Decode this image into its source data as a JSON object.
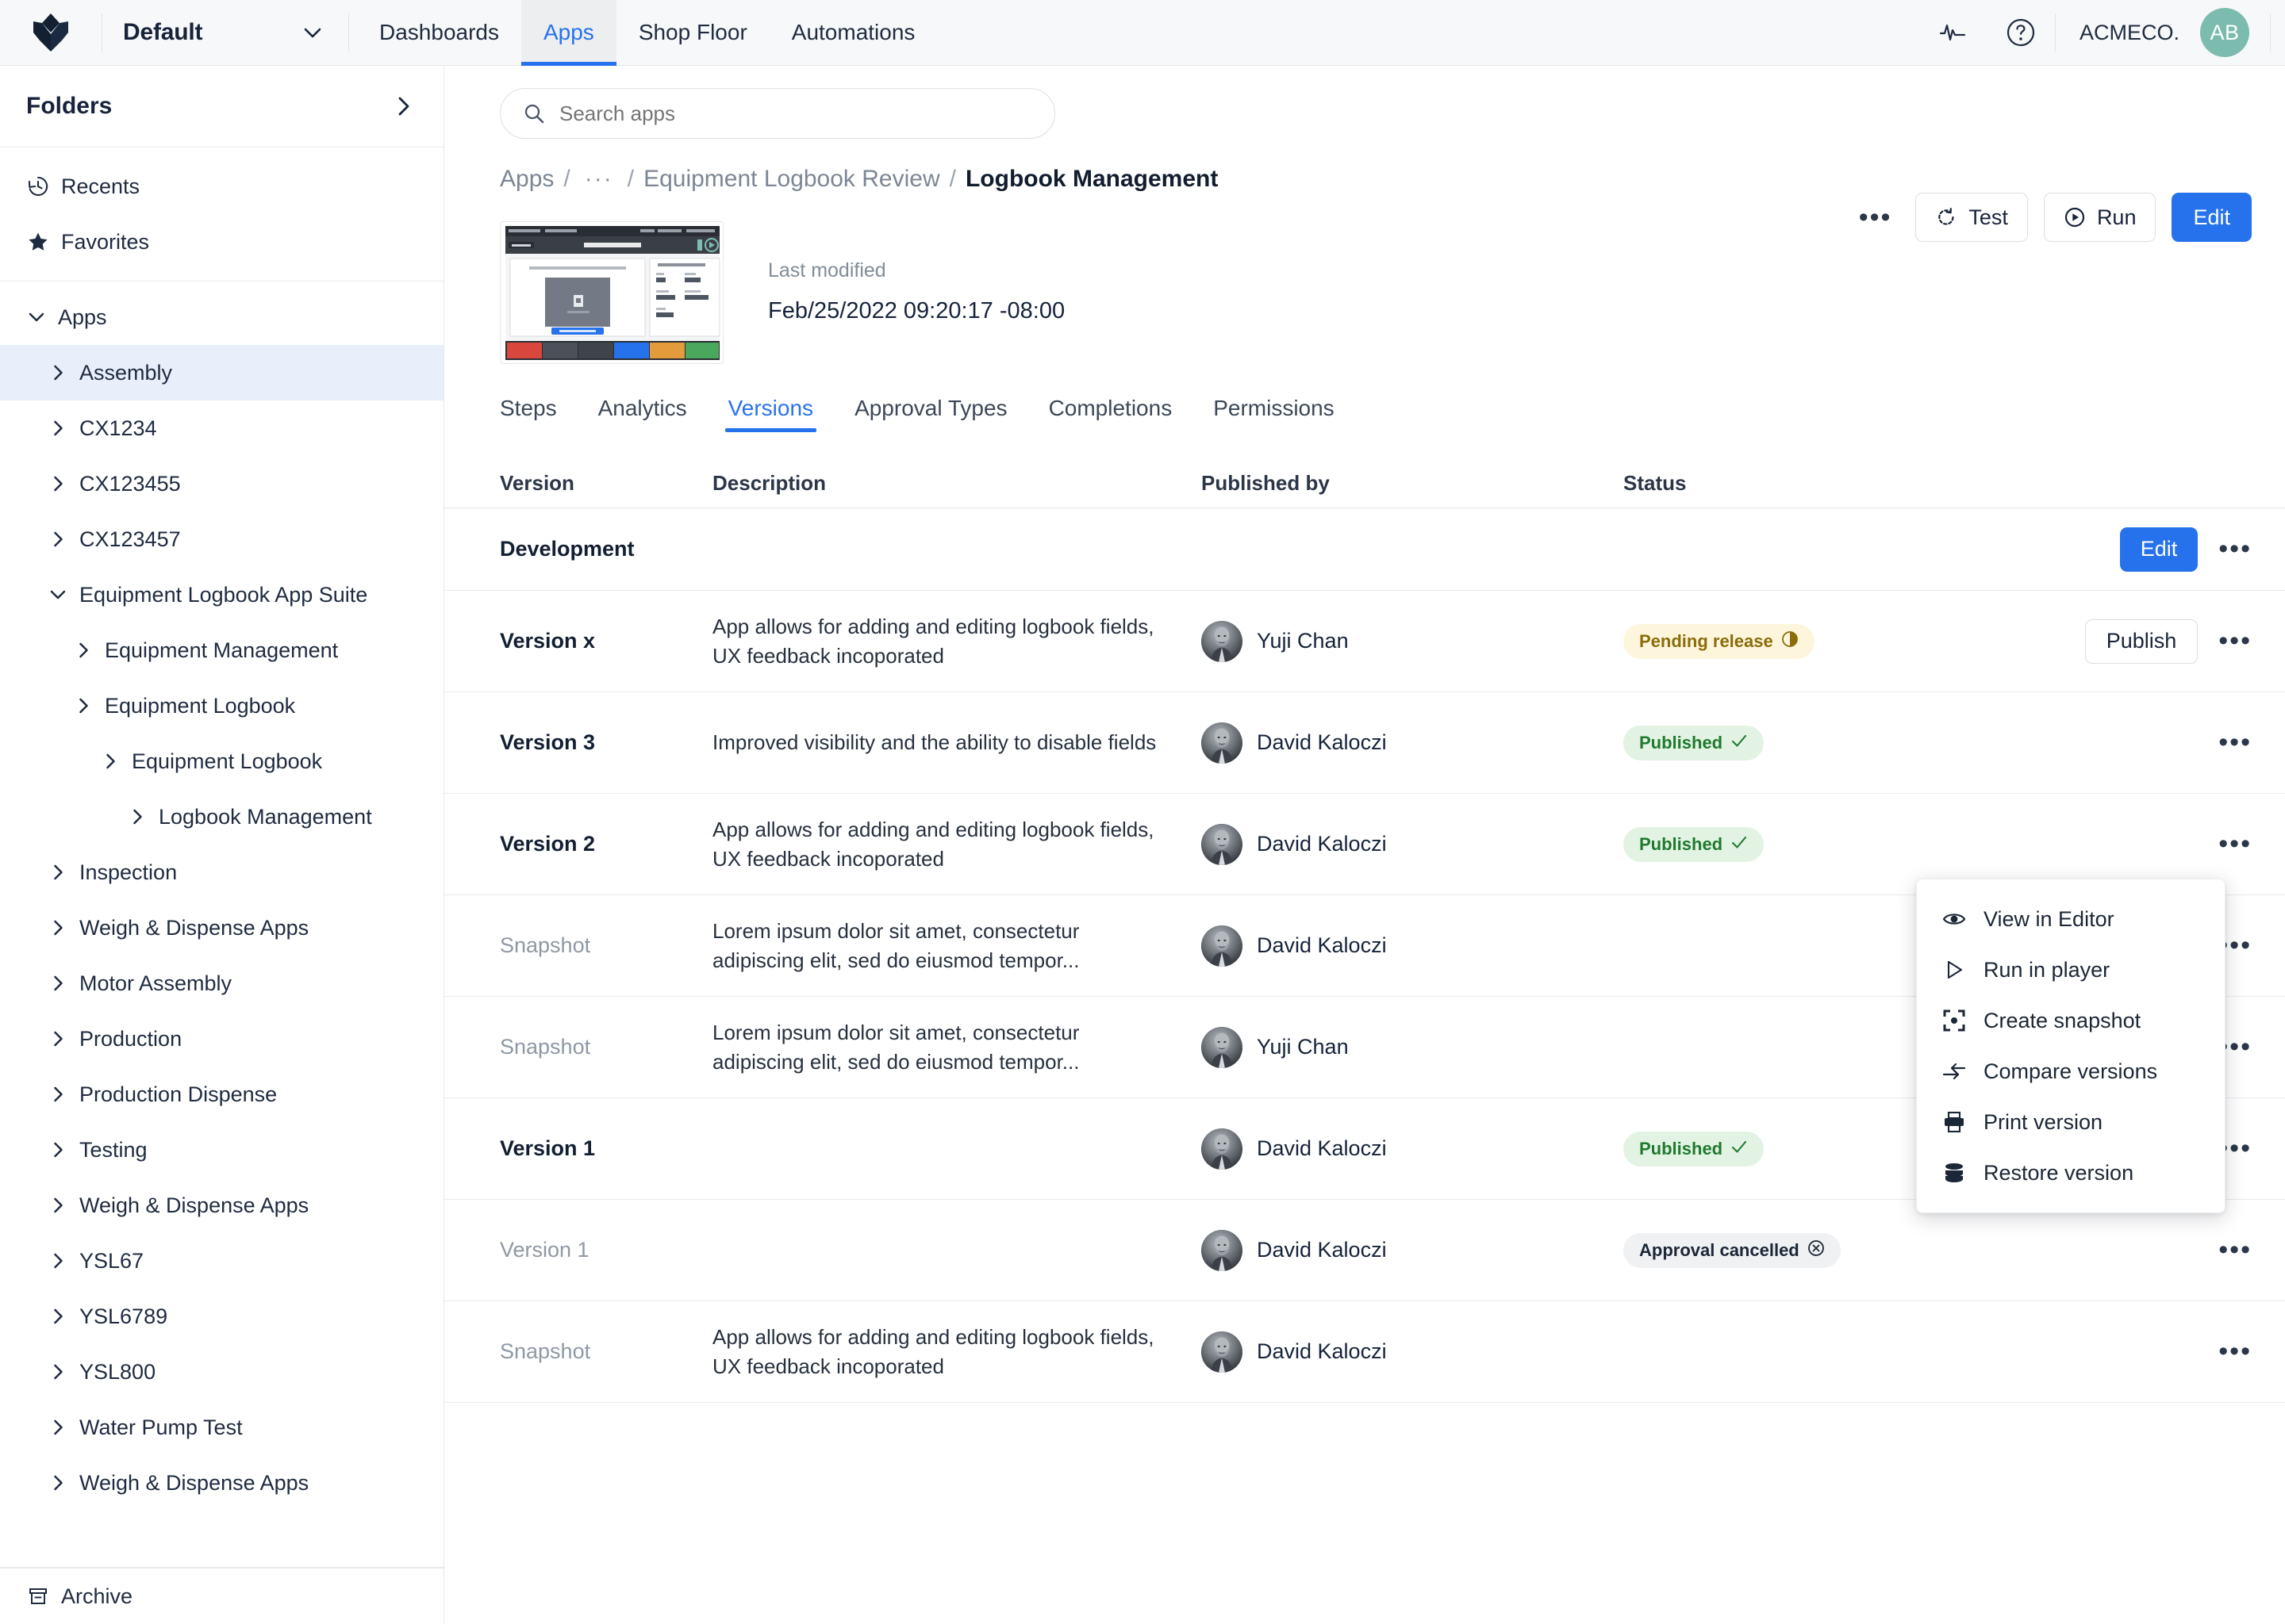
{
  "topbar": {
    "logo_icon": "tulip-logo-icon",
    "workspace": "Default",
    "workspace_chevron": "chevron-down-icon",
    "nav": [
      {
        "label": "Dashboards",
        "active": false
      },
      {
        "label": "Apps",
        "active": true
      },
      {
        "label": "Shop Floor",
        "active": false
      },
      {
        "label": "Automations",
        "active": false
      }
    ],
    "pulse_icon": "activity-pulse-icon",
    "help_icon": "help-circle-icon",
    "tenant": "ACMECO.",
    "avatar_initials": "AB"
  },
  "sidebar": {
    "title": "Folders",
    "collapse_icon": "chevron-right-icon",
    "quick": [
      {
        "label": "Recents",
        "icon": "history-icon"
      },
      {
        "label": "Favorites",
        "icon": "star-icon"
      }
    ],
    "tree": [
      {
        "label": "Apps",
        "level": 1,
        "state": "expanded",
        "selected": false
      },
      {
        "label": "Assembly",
        "level": 2,
        "state": "collapsed",
        "selected": true
      },
      {
        "label": "CX1234",
        "level": 2,
        "state": "collapsed",
        "selected": false
      },
      {
        "label": "CX123455",
        "level": 2,
        "state": "collapsed",
        "selected": false
      },
      {
        "label": "CX123457",
        "level": 2,
        "state": "collapsed",
        "selected": false
      },
      {
        "label": "Equipment Logbook App Suite",
        "level": 2,
        "state": "expanded",
        "selected": false
      },
      {
        "label": "Equipment Management",
        "level": 3,
        "state": "collapsed",
        "selected": false
      },
      {
        "label": "Equipment Logbook",
        "level": 3,
        "state": "collapsed",
        "selected": false
      },
      {
        "label": "Equipment Logbook",
        "level": 4,
        "state": "collapsed",
        "selected": false
      },
      {
        "label": "Logbook Management",
        "level": 5,
        "state": "collapsed",
        "selected": false
      },
      {
        "label": "Inspection",
        "level": 2,
        "state": "collapsed",
        "selected": false
      },
      {
        "label": "Weigh & Dispense Apps",
        "level": 2,
        "state": "collapsed",
        "selected": false
      },
      {
        "label": "Motor Assembly",
        "level": 2,
        "state": "collapsed",
        "selected": false
      },
      {
        "label": "Production",
        "level": 2,
        "state": "collapsed",
        "selected": false
      },
      {
        "label": "Production Dispense",
        "level": 2,
        "state": "collapsed",
        "selected": false
      },
      {
        "label": "Testing",
        "level": 2,
        "state": "collapsed",
        "selected": false
      },
      {
        "label": "Weigh & Dispense Apps",
        "level": 2,
        "state": "collapsed",
        "selected": false
      },
      {
        "label": "YSL67",
        "level": 2,
        "state": "collapsed",
        "selected": false
      },
      {
        "label": "YSL6789",
        "level": 2,
        "state": "collapsed",
        "selected": false
      },
      {
        "label": "YSL800",
        "level": 2,
        "state": "collapsed",
        "selected": false
      },
      {
        "label": "Water Pump Test",
        "level": 2,
        "state": "collapsed",
        "selected": false
      },
      {
        "label": "Weigh & Dispense Apps",
        "level": 2,
        "state": "collapsed",
        "selected": false
      }
    ],
    "archive": {
      "label": "Archive",
      "icon": "archive-icon"
    }
  },
  "search": {
    "placeholder": "Search apps",
    "value": "",
    "icon": "search-icon"
  },
  "breadcrumb": {
    "root": "Apps",
    "ellipsis": "···",
    "parent": "Equipment Logbook Review",
    "current": "Logbook Management",
    "separator": "/"
  },
  "header_actions": {
    "more_icon": "ellipsis-icon",
    "test_label": "Test",
    "test_icon": "rotate-ccw-icon",
    "run_label": "Run",
    "run_icon": "play-circle-icon",
    "edit_label": "Edit",
    "accent_color": "#2672ec"
  },
  "hero": {
    "thumbnail_icon": "app-preview-thumbnail",
    "last_modified_label": "Last modified",
    "last_modified_value": "Feb/25/2022 09:20:17 -08:00"
  },
  "tabs": [
    {
      "label": "Steps",
      "active": false
    },
    {
      "label": "Analytics",
      "active": false
    },
    {
      "label": "Versions",
      "active": true
    },
    {
      "label": "Approval Types",
      "active": false
    },
    {
      "label": "Completions",
      "active": false
    },
    {
      "label": "Permissions",
      "active": false
    }
  ],
  "table": {
    "columns": [
      "Version",
      "Description",
      "Published by",
      "Status"
    ],
    "dev_row": {
      "label": "Development",
      "edit_label": "Edit",
      "more_icon": "ellipsis-icon"
    },
    "rows": [
      {
        "version": "Version x",
        "version_muted": false,
        "description": "App allows for adding and editing logbook fields, UX feedback incoporated",
        "published_by": "Yuji Chan",
        "status": "Pending release",
        "status_kind": "pending",
        "status_icon": "half-moon-icon",
        "action_label": "Publish",
        "more_icon": "ellipsis-icon"
      },
      {
        "version": "Version 3",
        "version_muted": false,
        "description": "Improved visibility and the ability to disable fields",
        "published_by": "David Kaloczi",
        "status": "Published",
        "status_kind": "published",
        "status_icon": "check-icon",
        "action_label": "",
        "more_icon": "ellipsis-icon"
      },
      {
        "version": "Version 2",
        "version_muted": false,
        "description": "App allows for adding and editing logbook fields, UX feedback incoporated",
        "published_by": "David Kaloczi",
        "status": "Published",
        "status_kind": "published",
        "status_icon": "check-icon",
        "action_label": "",
        "more_icon": "ellipsis-icon"
      },
      {
        "version": "Snapshot",
        "version_muted": true,
        "description": "Lorem ipsum dolor sit amet, consectetur adipiscing elit, sed do eiusmod tempor...",
        "published_by": "David Kaloczi",
        "status": "",
        "status_kind": "none",
        "status_icon": "",
        "action_label": "",
        "more_icon": "ellipsis-icon"
      },
      {
        "version": "Snapshot",
        "version_muted": true,
        "description": "Lorem ipsum dolor sit amet, consectetur adipiscing elit, sed do eiusmod tempor...",
        "published_by": "Yuji Chan",
        "status": "",
        "status_kind": "none",
        "status_icon": "",
        "action_label": "",
        "more_icon": "ellipsis-icon"
      },
      {
        "version": "Version 1",
        "version_muted": false,
        "description": "",
        "published_by": "David Kaloczi",
        "status": "Published",
        "status_kind": "published",
        "status_icon": "check-icon",
        "action_label": "",
        "more_icon": "ellipsis-icon"
      },
      {
        "version": "Version 1",
        "version_muted": true,
        "description": "",
        "published_by": "David Kaloczi",
        "status": "Approval cancelled",
        "status_kind": "cancelled",
        "status_icon": "x-circle-icon",
        "action_label": "",
        "more_icon": "ellipsis-icon"
      },
      {
        "version": "Snapshot",
        "version_muted": true,
        "description": "App allows for adding and editing logbook fields, UX feedback incoporated",
        "published_by": "David Kaloczi",
        "status": "",
        "status_kind": "none",
        "status_icon": "",
        "action_label": "",
        "more_icon": "ellipsis-icon"
      }
    ]
  },
  "context_menu": {
    "items": [
      {
        "label": "View in Editor",
        "icon": "eye-icon"
      },
      {
        "label": "Run in player",
        "icon": "play-triangle-icon"
      },
      {
        "label": "Create snapshot",
        "icon": "snapshot-frame-icon"
      },
      {
        "label": "Compare versions",
        "icon": "compare-arrows-icon"
      },
      {
        "label": "Print version",
        "icon": "printer-icon"
      },
      {
        "label": "Restore version",
        "icon": "database-stack-icon"
      }
    ]
  }
}
